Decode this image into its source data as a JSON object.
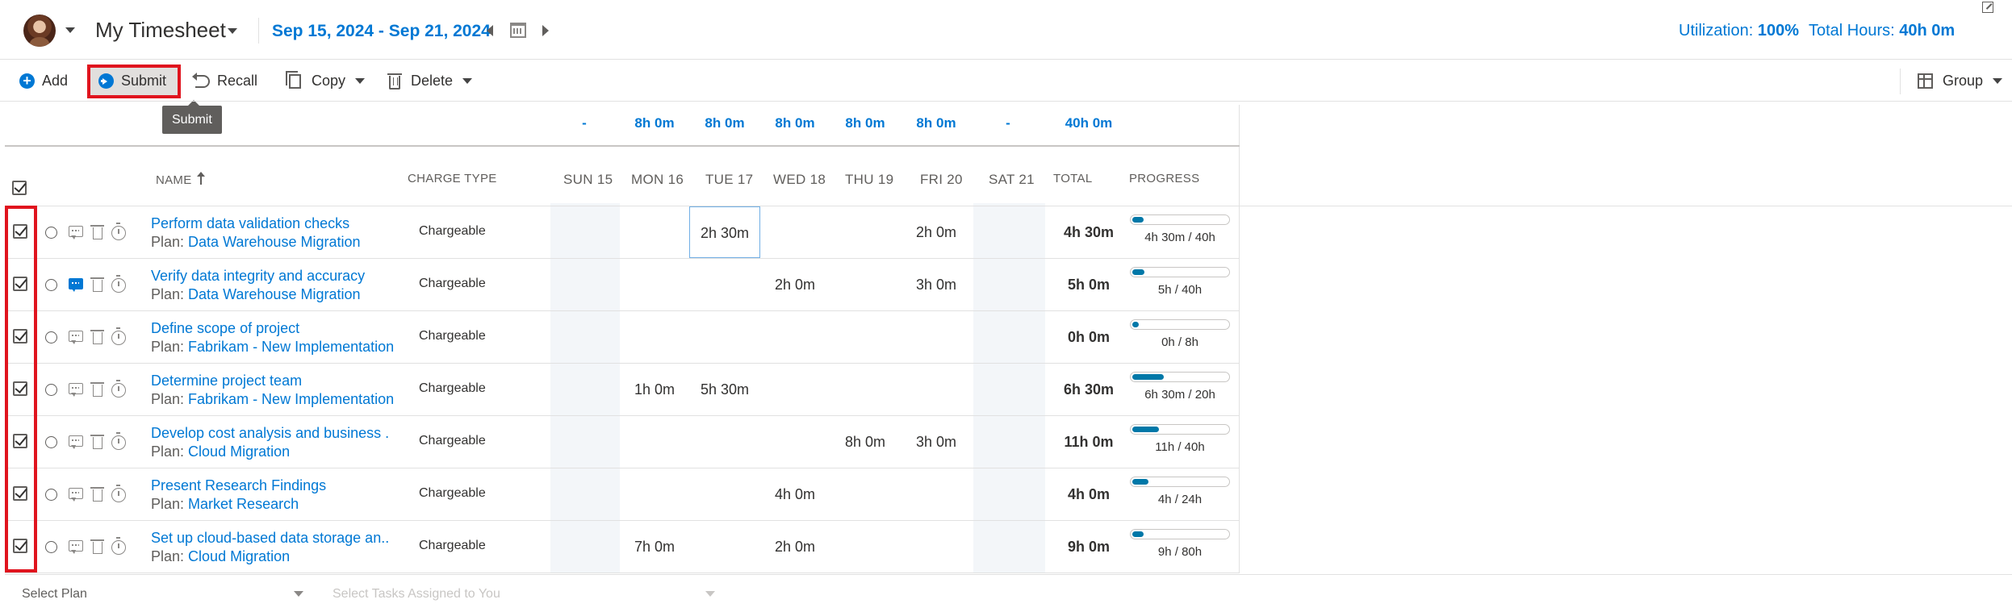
{
  "header": {
    "title": "My Timesheet",
    "date_range": "Sep 15, 2024 - Sep 21, 2024",
    "utilization_label": "Utilization:",
    "utilization_value": "100%",
    "total_hours_label": "Total Hours:",
    "total_hours_value": "40h 0m"
  },
  "toolbar": {
    "add": "Add",
    "submit": "Submit",
    "recall": "Recall",
    "copy": "Copy",
    "delete": "Delete",
    "group": "Group",
    "tooltip": "Submit"
  },
  "summary": {
    "sun": "-",
    "mon": "8h 0m",
    "tue": "8h 0m",
    "wed": "8h 0m",
    "thu": "8h 0m",
    "fri": "8h 0m",
    "sat": "-",
    "total": "40h 0m"
  },
  "columns": {
    "name": "NAME",
    "charge_type": "CHARGE TYPE",
    "sun": "SUN 15",
    "mon": "MON 16",
    "tue": "TUE 17",
    "wed": "WED 18",
    "thu": "THU 19",
    "fri": "FRI 20",
    "sat": "SAT 21",
    "total": "TOTAL",
    "progress": "PROGRESS"
  },
  "rows": [
    {
      "name": "Perform data validation checks",
      "plan_prefix": "Plan:",
      "plan": "Data Warehouse Migration",
      "charge_type": "Chargeable",
      "sun": "",
      "mon": "",
      "tue": "2h 30m",
      "wed": "",
      "thu": "",
      "fri": "2h 0m",
      "sat": "",
      "total": "4h 30m",
      "progress": "4h 30m / 40h",
      "progress_fraction": 0.1125
    },
    {
      "name": "Verify data integrity and accuracy",
      "plan_prefix": "Plan:",
      "plan": "Data Warehouse Migration",
      "charge_type": "Chargeable",
      "sun": "",
      "mon": "",
      "tue": "",
      "wed": "2h 0m",
      "thu": "",
      "fri": "3h 0m",
      "sat": "",
      "total": "5h 0m",
      "progress": "5h / 40h",
      "progress_fraction": 0.125
    },
    {
      "name": "Define scope of project",
      "plan_prefix": "Plan:",
      "plan": "Fabrikam - New Implementation",
      "charge_type": "Chargeable",
      "sun": "",
      "mon": "",
      "tue": "",
      "wed": "",
      "thu": "",
      "fri": "",
      "sat": "",
      "total": "0h 0m",
      "progress": "0h / 8h",
      "progress_fraction": 0
    },
    {
      "name": "Determine project team",
      "plan_prefix": "Plan:",
      "plan": "Fabrikam - New Implementation",
      "charge_type": "Chargeable",
      "sun": "",
      "mon": "1h 0m",
      "tue": "5h 30m",
      "wed": "",
      "thu": "",
      "fri": "",
      "sat": "",
      "total": "6h 30m",
      "progress": "6h 30m / 20h",
      "progress_fraction": 0.325
    },
    {
      "name": "Develop cost analysis and business ...",
      "plan_prefix": "Plan:",
      "plan": "Cloud Migration",
      "charge_type": "Chargeable",
      "sun": "",
      "mon": "",
      "tue": "",
      "wed": "",
      "thu": "8h 0m",
      "fri": "3h 0m",
      "sat": "",
      "total": "11h 0m",
      "progress": "11h / 40h",
      "progress_fraction": 0.275
    },
    {
      "name": "Present Research Findings",
      "plan_prefix": "Plan:",
      "plan": "Market Research",
      "charge_type": "Chargeable",
      "sun": "",
      "mon": "",
      "tue": "",
      "wed": "4h 0m",
      "thu": "",
      "fri": "",
      "sat": "",
      "total": "4h 0m",
      "progress": "4h / 24h",
      "progress_fraction": 0.1667
    },
    {
      "name": "Set up cloud-based data storage an...",
      "plan_prefix": "Plan:",
      "plan": "Cloud Migration",
      "charge_type": "Chargeable",
      "sun": "",
      "mon": "7h 0m",
      "tue": "",
      "wed": "2h 0m",
      "thu": "",
      "fri": "",
      "sat": "",
      "total": "9h 0m",
      "progress": "9h / 80h",
      "progress_fraction": 0.1125
    }
  ],
  "footer": {
    "select_plan": "Select Plan",
    "select_tasks": "Select Tasks Assigned to You"
  },
  "colors": {
    "accent": "#0078d4",
    "highlight": "#e0141e",
    "progress": "#0078a8"
  }
}
